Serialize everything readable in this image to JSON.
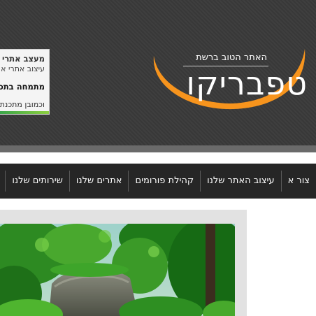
{
  "header": {
    "logo": {
      "slogan": "האתר הטוב ברשת",
      "name": "טפבריקו",
      "arc_color": "#f7941d"
    },
    "ad_banner": {
      "line1": "מעצב אתרי א",
      "line2": "עיצוב אתרי א",
      "line3": "מתמחה בתכ",
      "line4": "וכמובן מתכנת"
    }
  },
  "nav": {
    "items": [
      "שירותים שלנו",
      "אתרים שלנו",
      "קהילת פורומים",
      "עיצוב האתר שלנו",
      "צור א"
    ]
  },
  "main": {
    "image": {
      "alt": "nature-photo"
    }
  },
  "colors": {
    "header_bg": "#3a3a3a",
    "nav_bg": "#262626",
    "content_bg": "#e2e2e2",
    "accent": "#f7941d"
  }
}
